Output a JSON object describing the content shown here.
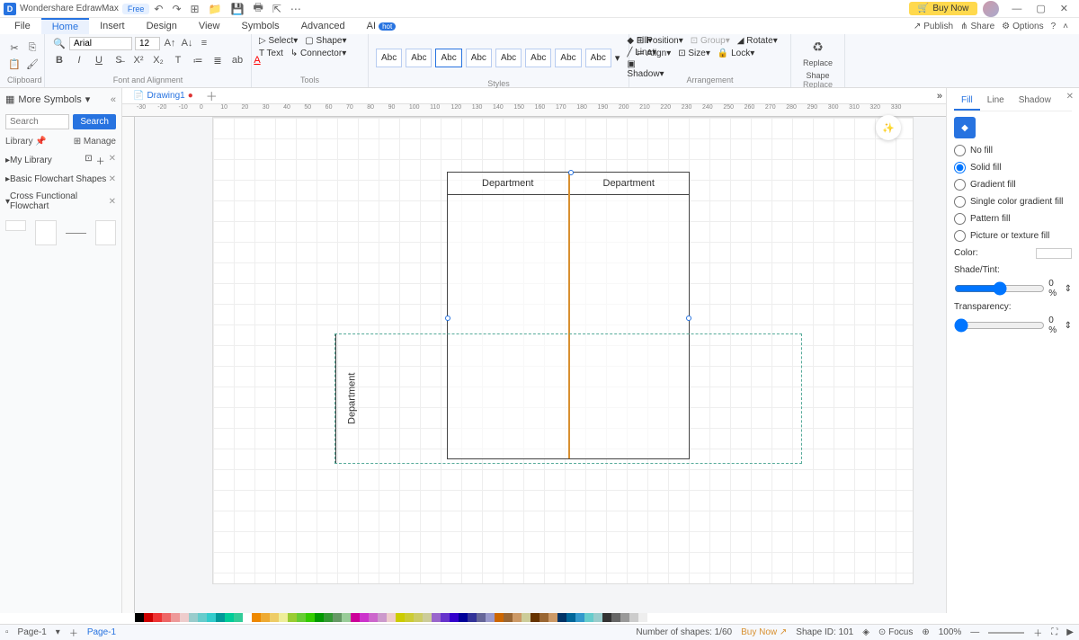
{
  "title": {
    "app": "Wondershare EdrawMax",
    "badge": "Free",
    "buy": "Buy Now"
  },
  "menu": {
    "items": [
      "File",
      "Home",
      "Insert",
      "Design",
      "View",
      "Symbols",
      "Advanced",
      "AI"
    ],
    "hot": "hot",
    "right": [
      "Publish",
      "Share",
      "Options"
    ]
  },
  "ribbon": {
    "font": "Arial",
    "size": "12",
    "select": "Select",
    "shape": "Shape",
    "text": "Text",
    "connector": "Connector",
    "abc": "Abc",
    "fill": "Fill",
    "line": "Line",
    "shadow": "Shadow",
    "position": "Position",
    "group": "Group",
    "rotate": "Rotate",
    "align": "Align",
    "sizebtn": "Size",
    "lock": "Lock",
    "replace1": "Replace",
    "replace2": "Shape",
    "g": {
      "clipboard": "Clipboard",
      "font": "Font and Alignment",
      "tools": "Tools",
      "styles": "Styles",
      "arrange": "Arrangement",
      "replace": "Replace"
    }
  },
  "left": {
    "title": "More Symbols",
    "search_ph": "Search",
    "search_btn": "Search",
    "library": "Library",
    "manage": "Manage",
    "mylib": "My Library",
    "sec1": "Basic Flowchart Shapes",
    "sec2": "Cross Functional Flowchart"
  },
  "tabs": {
    "drawing": "Drawing1"
  },
  "canvas": {
    "dept": "Department"
  },
  "right": {
    "tabs": [
      "Fill",
      "Line",
      "Shadow"
    ],
    "nofill": "No fill",
    "solid": "Solid fill",
    "gradient": "Gradient fill",
    "single": "Single color gradient fill",
    "pattern": "Pattern fill",
    "picture": "Picture or texture fill",
    "color": "Color:",
    "shade": "Shade/Tint:",
    "trans": "Transparency:",
    "pct": "0 %"
  },
  "status": {
    "page": "Page-1",
    "page2": "Page-1",
    "shapes": "Number of shapes: 1/60",
    "buy": "Buy Now",
    "shapeid": "Shape ID: 101",
    "focus": "Focus",
    "zoom": "100%"
  },
  "ruler_h": [
    "-30",
    "-20",
    "-10",
    "0",
    "10",
    "20",
    "30",
    "40",
    "50",
    "60",
    "70",
    "80",
    "90",
    "100",
    "110",
    "120",
    "130",
    "140",
    "150",
    "160",
    "170",
    "180",
    "190",
    "200",
    "210",
    "220",
    "230",
    "240",
    "250",
    "260",
    "270",
    "280",
    "290",
    "300",
    "310",
    "320",
    "330"
  ]
}
